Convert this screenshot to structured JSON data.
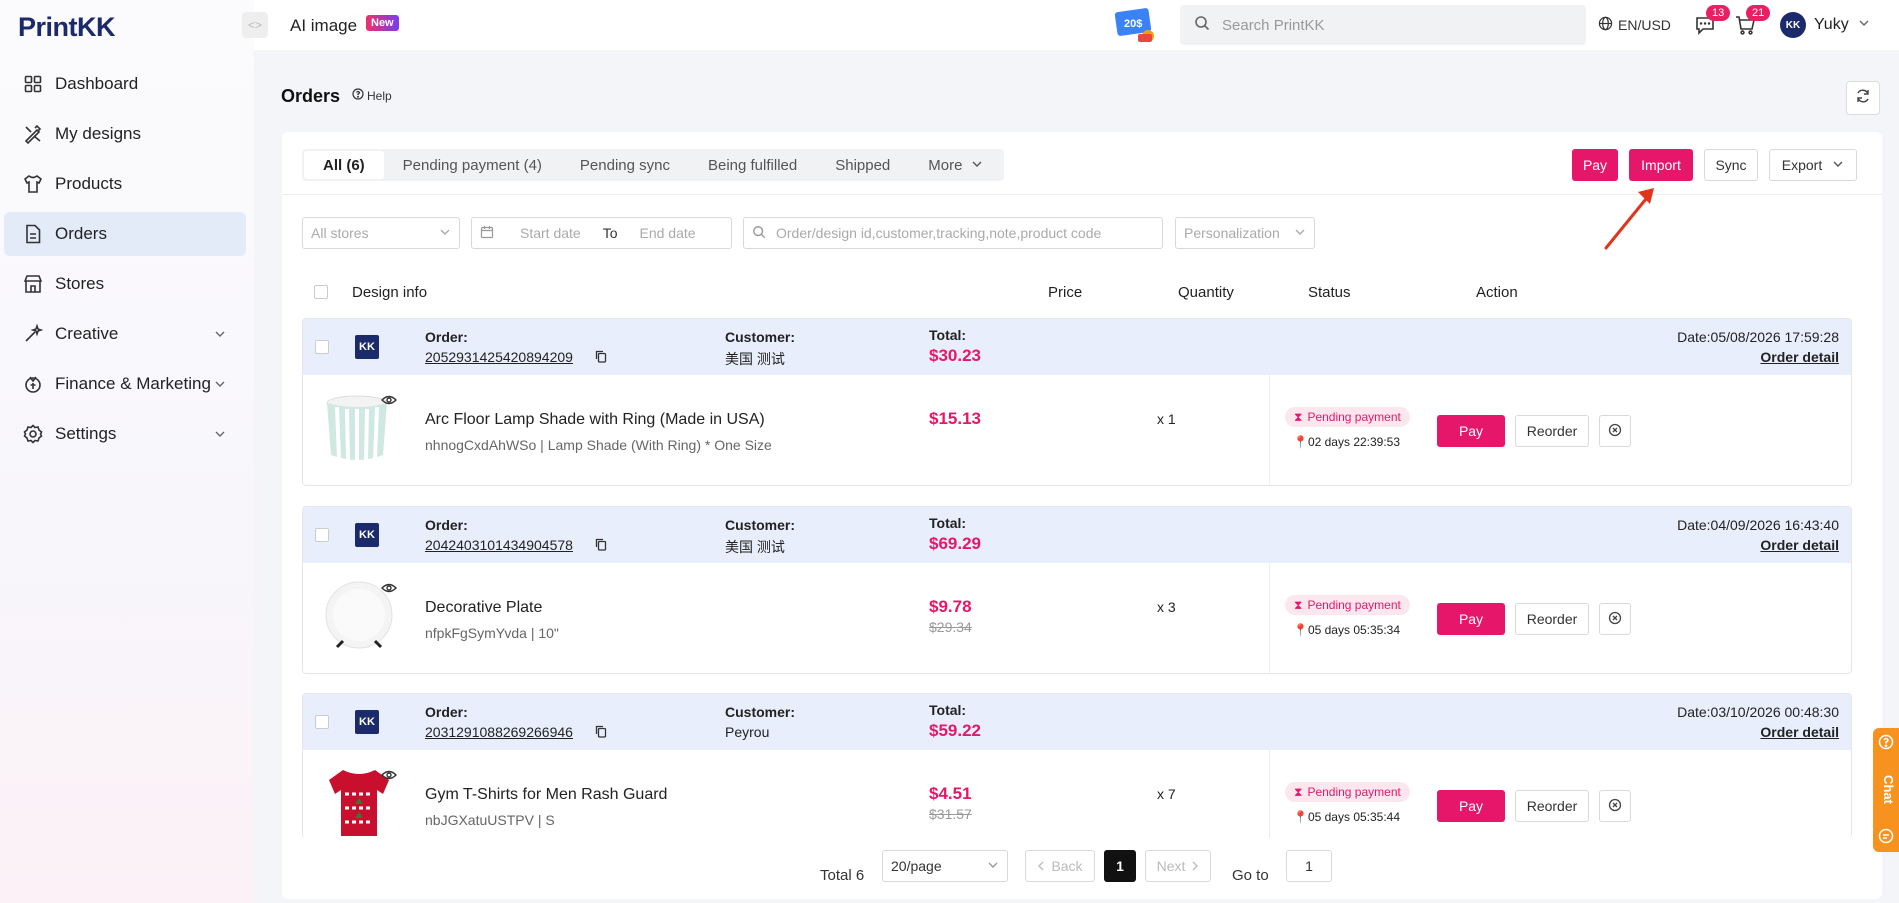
{
  "brand": {
    "logo_print": "Print",
    "logo_kk": "KK"
  },
  "sidebar": {
    "items": [
      {
        "label": "Dashboard",
        "icon": "dashboard-icon"
      },
      {
        "label": "My designs",
        "icon": "designs-icon"
      },
      {
        "label": "Products",
        "icon": "shirt-icon"
      },
      {
        "label": "Orders",
        "icon": "document-icon",
        "active": true
      },
      {
        "label": "Stores",
        "icon": "store-icon"
      },
      {
        "label": "Creative",
        "icon": "creative-icon"
      },
      {
        "label": "Finance & Marketing",
        "icon": "finance-icon"
      },
      {
        "label": "Settings",
        "icon": "gear-icon"
      }
    ]
  },
  "header": {
    "ai_image": "AI image",
    "new_badge": "New",
    "promo_text": "20$",
    "search_placeholder": "Search PrintKK",
    "lang": "EN/USD",
    "messages_count": "13",
    "cart_count": "21",
    "user_name": "Yuky"
  },
  "page": {
    "title": "Orders",
    "help": "Help"
  },
  "tabs": [
    "All (6)",
    "Pending payment (4)",
    "Pending sync",
    "Being fulfilled",
    "Shipped",
    "More"
  ],
  "actions": {
    "pay": "Pay",
    "import": "Import",
    "sync": "Sync",
    "export": "Export"
  },
  "filters": {
    "stores": "All stores",
    "start_date": "Start date",
    "to": "To",
    "end_date": "End date",
    "search_placeholder": "Order/design id,customer,tracking,note,product code",
    "personalization": "Personalization"
  },
  "table_headers": {
    "design": "Design info",
    "price": "Price",
    "quantity": "Quantity",
    "status": "Status",
    "action": "Action"
  },
  "labels": {
    "order": "Order:",
    "customer": "Customer:",
    "total": "Total:",
    "order_detail": "Order detail",
    "pay": "Pay",
    "reorder": "Reorder"
  },
  "orders": [
    {
      "order_id": "2052931425420894209",
      "customer": "美国 测试",
      "total": "$30.23",
      "date": "Date:05/08/2026 17:59:28",
      "product": "Arc Floor Lamp Shade with Ring (Made in USA)",
      "sku": "nhnogCxdAhWSo | Lamp Shade (With Ring) * One Size",
      "price": "$15.13",
      "original_price": "",
      "qty": "x 1",
      "status": "Pending payment",
      "timer": "02 days 22:39:53"
    },
    {
      "order_id": "2042403101434904578",
      "customer": "美国 测试",
      "total": "$69.29",
      "date": "Date:04/09/2026 16:43:40",
      "product": "Decorative Plate",
      "sku": "nfpkFgSymYvda | 10\"",
      "price": "$9.78",
      "original_price": "$29.34",
      "qty": "x 3",
      "status": "Pending payment",
      "timer": "05 days 05:35:34"
    },
    {
      "order_id": "2031291088269266946",
      "customer": "Peyrou",
      "total": "$59.22",
      "date": "Date:03/10/2026 00:48:30",
      "product": "Gym T-Shirts for Men Rash Guard",
      "sku": "nbJGXatuUSTPV | S",
      "price": "$4.51",
      "original_price": "$31.57",
      "qty": "x 7",
      "status": "Pending payment",
      "timer": "05 days 05:35:44"
    }
  ],
  "pagination": {
    "total": "Total 6",
    "per_page": "20/page",
    "back": "Back",
    "current": "1",
    "next": "Next",
    "goto": "Go to",
    "goto_value": "1"
  },
  "chat": {
    "label": "Chat"
  },
  "colors": {
    "accent": "#e6176a",
    "brand": "#1b2a6b",
    "active_nav": "#e3ebf9",
    "order_header": "#e8eefb"
  }
}
